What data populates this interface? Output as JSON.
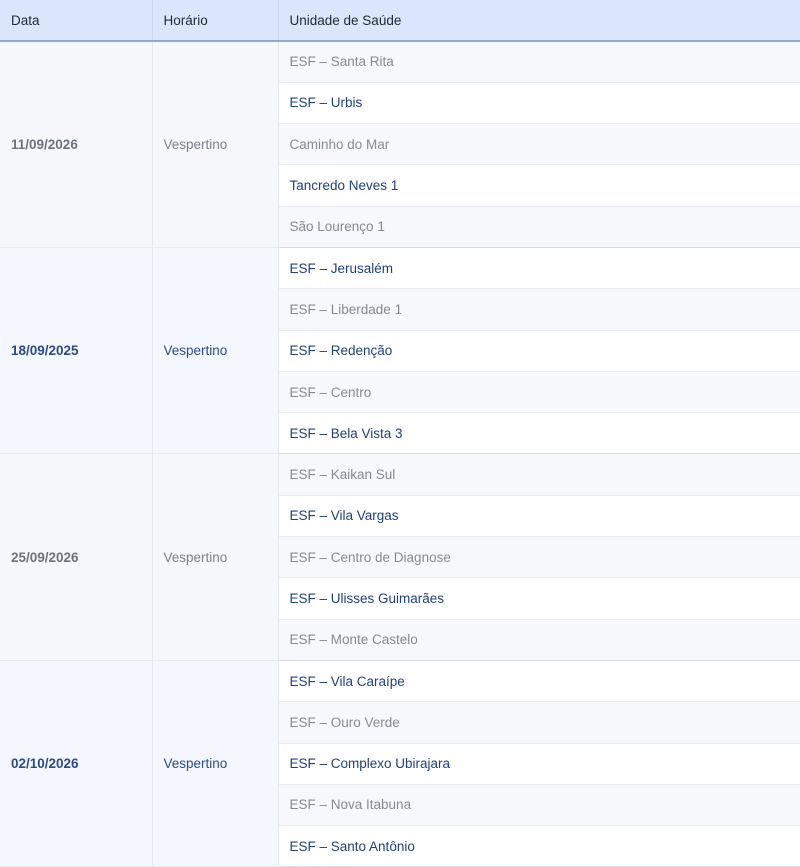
{
  "headers": {
    "date": "Data",
    "shift": "Horário",
    "unit": "Unidade de Saúde"
  },
  "groups": [
    {
      "date": "11/09/2026",
      "shift": "Vespertino",
      "style": "muted",
      "units": [
        {
          "name": "ESF – Santa Rita",
          "style": "muted"
        },
        {
          "name": "ESF – Urbis",
          "style": "accent"
        },
        {
          "name": "Caminho do Mar",
          "style": "muted"
        },
        {
          "name": "Tancredo Neves 1",
          "style": "accent"
        },
        {
          "name": "São Lourenço 1",
          "style": "muted"
        }
      ]
    },
    {
      "date": "18/09/2025",
      "shift": "Vespertino",
      "style": "accent",
      "units": [
        {
          "name": "ESF – Jerusalém",
          "style": "accent"
        },
        {
          "name": "ESF – Liberdade 1",
          "style": "muted"
        },
        {
          "name": "ESF – Redenção",
          "style": "accent"
        },
        {
          "name": "ESF – Centro",
          "style": "muted"
        },
        {
          "name": "ESF – Bela Vista 3",
          "style": "accent"
        }
      ]
    },
    {
      "date": "25/09/2026",
      "shift": "Vespertino",
      "style": "muted",
      "units": [
        {
          "name": "ESF – Kaikan Sul",
          "style": "muted"
        },
        {
          "name": "ESF – Vila Vargas",
          "style": "accent"
        },
        {
          "name": "ESF – Centro de Diagnose",
          "style": "muted"
        },
        {
          "name": "ESF – Ulisses Guimarães",
          "style": "accent"
        },
        {
          "name": "ESF – Monte Castelo",
          "style": "muted"
        }
      ]
    },
    {
      "date": "02/10/2026",
      "shift": "Vespertino",
      "style": "accent",
      "units": [
        {
          "name": "ESF – Vila Caraípe",
          "style": "accent"
        },
        {
          "name": "ESF – Ouro Verde",
          "style": "muted"
        },
        {
          "name": "ESF – Complexo Ubirajara",
          "style": "accent"
        },
        {
          "name": "ESF – Nova Itabuna",
          "style": "muted"
        },
        {
          "name": "ESF – Santo Antônio",
          "style": "accent"
        }
      ]
    }
  ]
}
